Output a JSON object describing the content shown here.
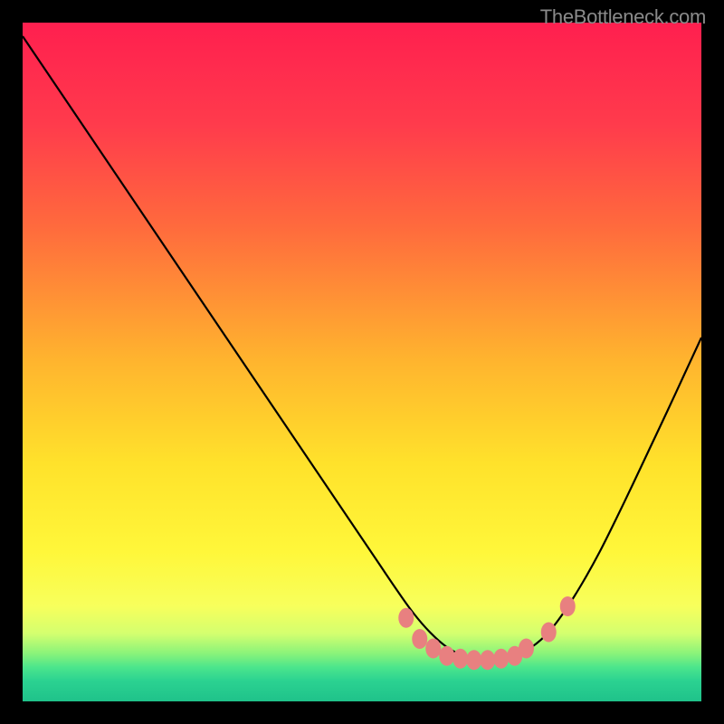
{
  "watermark": "TheBottleneck.com",
  "chart_data": {
    "type": "line",
    "title": "",
    "xlabel": "",
    "ylabel": "",
    "xlim": [
      0,
      100
    ],
    "ylim": [
      0,
      100
    ],
    "x": [
      0,
      2.5,
      5,
      7.5,
      10,
      12.5,
      15,
      17.5,
      20,
      22.5,
      25,
      27.5,
      30,
      32.5,
      35,
      37.5,
      40,
      42.5,
      45,
      47.5,
      50,
      52.5,
      55,
      57.5,
      60,
      62.5,
      65,
      67.5,
      70,
      72.5,
      75,
      77.5,
      80,
      82.5,
      85,
      87.5,
      90,
      92.5,
      95,
      97.5,
      100
    ],
    "values": [
      98,
      94.3,
      90.6,
      86.9,
      83.2,
      79.5,
      75.8,
      72.1,
      68.4,
      64.7,
      61,
      57.3,
      53.6,
      49.9,
      46.2,
      42.5,
      38.8,
      35.1,
      31.4,
      27.7,
      24,
      20.3,
      16.6,
      13.1,
      10.2,
      8,
      6.7,
      6.1,
      6.1,
      6.7,
      8,
      10.2,
      13.5,
      17.5,
      22,
      27,
      32.2,
      37.5,
      42.8,
      48.2,
      53.6
    ],
    "marker_points": [
      {
        "x": 56.5,
        "y": 12.3
      },
      {
        "x": 58.5,
        "y": 9.2
      },
      {
        "x": 60.5,
        "y": 7.8
      },
      {
        "x": 62.5,
        "y": 6.7
      },
      {
        "x": 64.5,
        "y": 6.3
      },
      {
        "x": 66.5,
        "y": 6.1
      },
      {
        "x": 68.5,
        "y": 6.1
      },
      {
        "x": 70.5,
        "y": 6.3
      },
      {
        "x": 72.5,
        "y": 6.7
      },
      {
        "x": 74.2,
        "y": 7.8
      },
      {
        "x": 77.5,
        "y": 10.2
      },
      {
        "x": 80.3,
        "y": 14.0
      }
    ],
    "gradient_stops": [
      {
        "offset": 0,
        "color": "#ff1f4f"
      },
      {
        "offset": 15,
        "color": "#ff3b4c"
      },
      {
        "offset": 30,
        "color": "#ff6a3d"
      },
      {
        "offset": 50,
        "color": "#ffb52e"
      },
      {
        "offset": 65,
        "color": "#ffe22b"
      },
      {
        "offset": 78,
        "color": "#fff73a"
      },
      {
        "offset": 86,
        "color": "#f7ff5c"
      },
      {
        "offset": 90,
        "color": "#d4ff6f"
      },
      {
        "offset": 93,
        "color": "#88f37a"
      },
      {
        "offset": 95,
        "color": "#4be58c"
      },
      {
        "offset": 97,
        "color": "#2bd291"
      },
      {
        "offset": 100,
        "color": "#1fc28a"
      }
    ],
    "marker_color": "#e88080",
    "curve_color": "#000000"
  }
}
